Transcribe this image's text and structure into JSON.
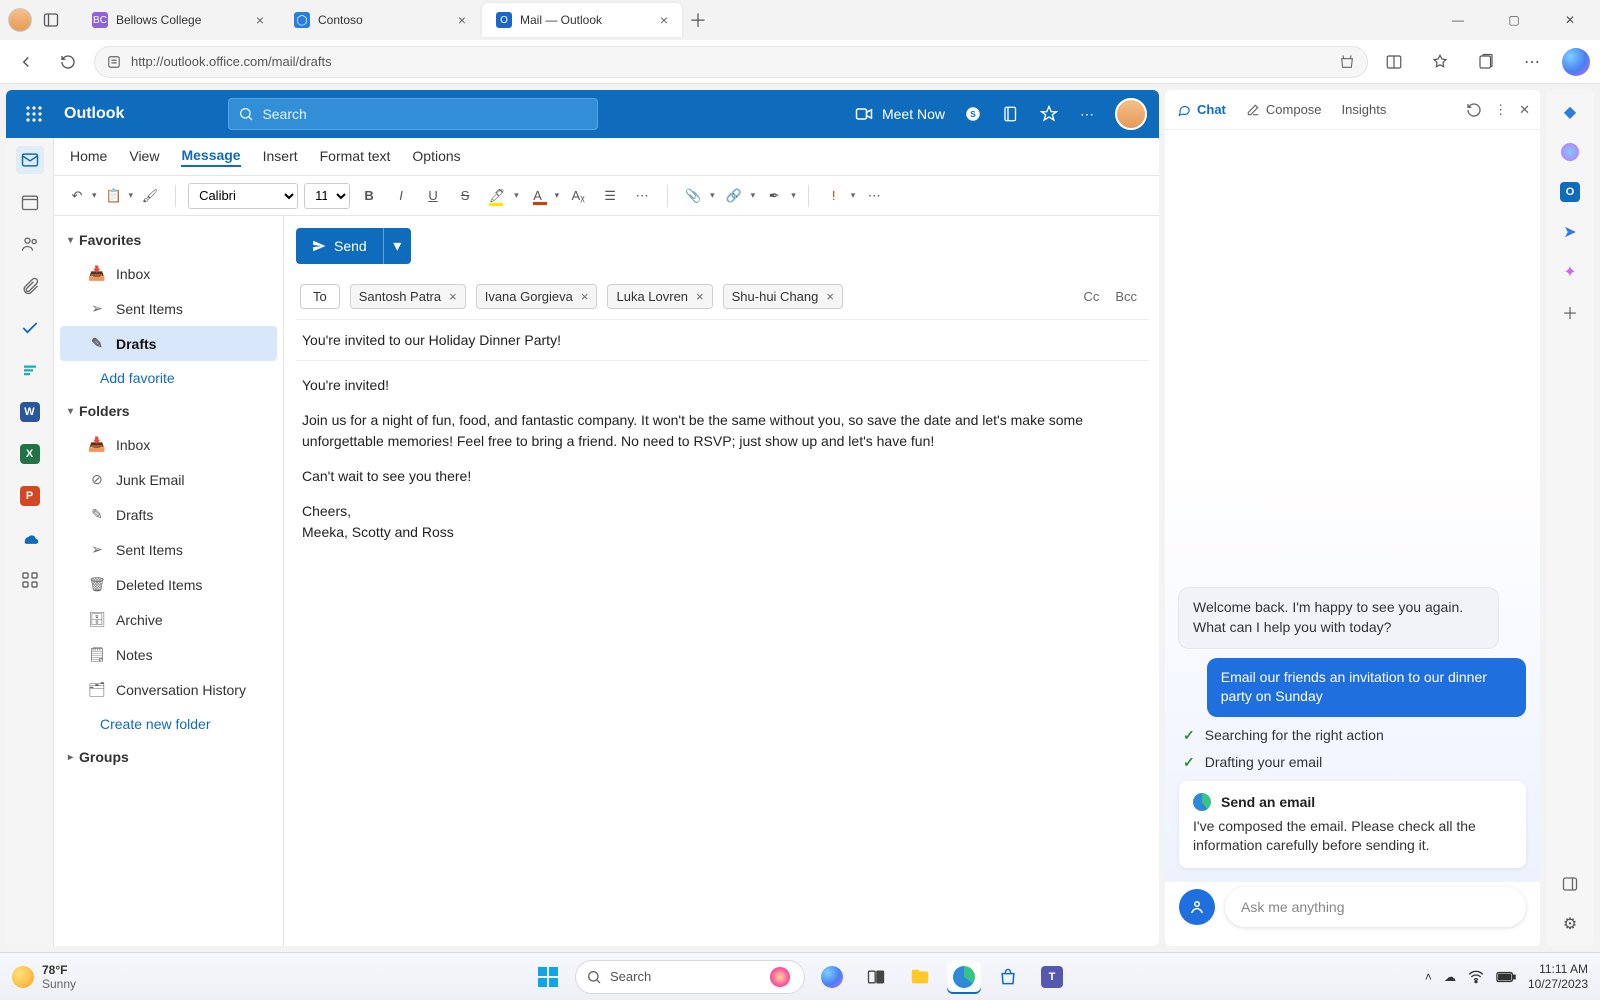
{
  "browser": {
    "tabs": [
      {
        "label": "Bellows College",
        "favicon_bg": "#8c63d8",
        "favicon_text": "BC"
      },
      {
        "label": "Contoso",
        "favicon_bg": "#2a7de1",
        "favicon_text": "◯"
      },
      {
        "label": "Mail — Outlook",
        "favicon_bg": "#1b66c9",
        "favicon_text": "O"
      }
    ],
    "url": "http://outlook.office.com/mail/drafts"
  },
  "outlook": {
    "app_name": "Outlook",
    "search_placeholder": "Search",
    "meet_now": "Meet Now",
    "ribbon_tabs": [
      "Home",
      "View",
      "Message",
      "Insert",
      "Format text",
      "Options"
    ],
    "font_name": "Calibri",
    "font_size": "11",
    "folders": {
      "favorites_label": "Favorites",
      "favorites": [
        "Inbox",
        "Sent Items",
        "Drafts"
      ],
      "add_favorite": "Add favorite",
      "folders_label": "Folders",
      "items": [
        "Inbox",
        "Junk Email",
        "Drafts",
        "Sent Items",
        "Deleted Items",
        "Archive",
        "Notes",
        "Conversation History"
      ],
      "create_new": "Create new folder",
      "groups_label": "Groups"
    },
    "compose": {
      "send_label": "Send",
      "to_label": "To",
      "cc_label": "Cc",
      "bcc_label": "Bcc",
      "recipients": [
        "Santosh Patra",
        "Ivana Gorgieva",
        "Luka Lovren",
        "Shu-hui Chang"
      ],
      "subject": "You're invited to our Holiday Dinner Party!",
      "body_line1": "You're invited!",
      "body_line2": "Join us for a night of fun, food, and fantastic company. It won't be the same without you, so save the date and let's make some unforgettable memories! Feel free to bring a friend. No need to RSVP; just show up and let's have fun!",
      "body_line3": "Can't wait to see you there!",
      "body_sig1": "Cheers,",
      "body_sig2": "Meeka, Scotty and Ross"
    }
  },
  "copilot": {
    "tabs": {
      "chat": "Chat",
      "compose": "Compose",
      "insights": "Insights"
    },
    "greeting": "Welcome back. I'm happy to see you again. What can I help you with today?",
    "user_msg": "Email our friends an invitation to our dinner party on Sunday",
    "status1": "Searching for the right action",
    "status2": "Drafting your email",
    "card_title": "Send an email",
    "card_text": "I've composed the email. Please check all the information carefully before sending it.",
    "input_placeholder": "Ask me anything"
  },
  "taskbar": {
    "temp": "78°F",
    "weather": "Sunny",
    "search_placeholder": "Search",
    "time": "11:11 AM",
    "date": "10/27/2023"
  }
}
